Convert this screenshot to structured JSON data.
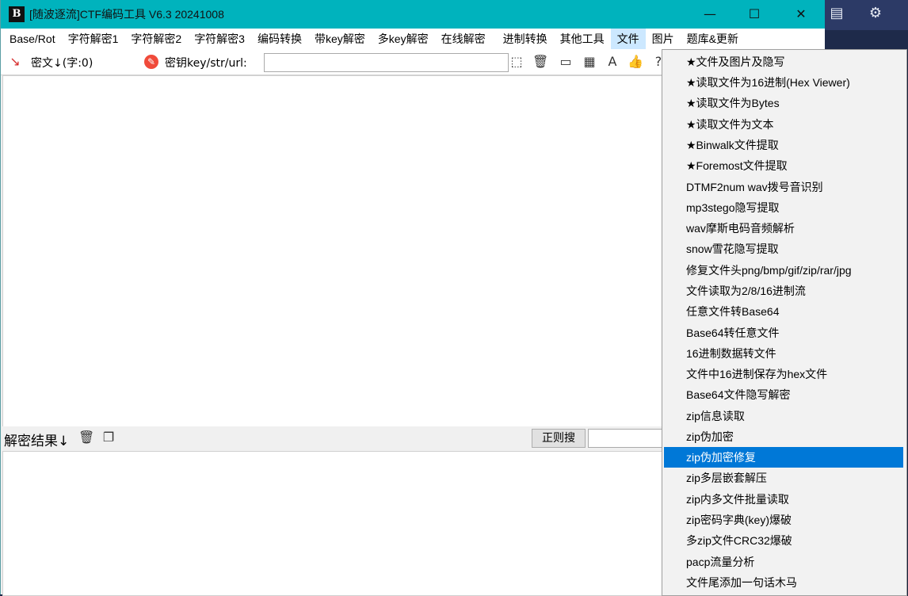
{
  "window": {
    "logo": "B",
    "title": "[随波逐流]CTF编码工具 V6.3 20241008",
    "minimize": "—",
    "maximize": "☐",
    "close": "✕"
  },
  "menu": [
    "Base/Rot",
    "字符解密1",
    "字符解密2",
    "字符解密3",
    "编码转换",
    "带key解密",
    "多key解密",
    "在线解密",
    "进制转换",
    "其他工具",
    "文件",
    "图片",
    "题库&更新"
  ],
  "toolbar": {
    "cipher_label": "密文↓(字:0)",
    "key_label": "密钥key/str/url:",
    "key_value": ""
  },
  "result": {
    "label": "解密结果↓",
    "regex_button": "正则搜"
  },
  "file_menu": {
    "items": [
      "★文件及图片及隐写",
      "★读取文件为16进制(Hex Viewer)",
      "★读取文件为Bytes",
      "★读取文件为文本",
      "★Binwalk文件提取",
      "★Foremost文件提取",
      "DTMF2num  wav拨号音识别",
      "mp3stego隐写提取",
      "wav摩斯电码音频解析",
      "snow雪花隐写提取",
      "修复文件头png/bmp/gif/zip/rar/jpg",
      "文件读取为2/8/16进制流",
      "任意文件转Base64",
      "Base64转任意文件",
      "16进制数据转文件",
      "文件中16进制保存为hex文件",
      "Base64文件隐写解密",
      "zip信息读取",
      "zip伪加密",
      "zip伪加密修复",
      "zip多层嵌套解压",
      "zip内多文件批量读取",
      "zip密码字典(key)爆破",
      "多zip文件CRC32爆破",
      "pacp流量分析",
      "文件尾添加一句话木马"
    ],
    "highlighted_item": "zip伪加密修复"
  },
  "colors": {
    "titlebar": "#00b3bd",
    "menu_highlight": "#0078d7"
  }
}
